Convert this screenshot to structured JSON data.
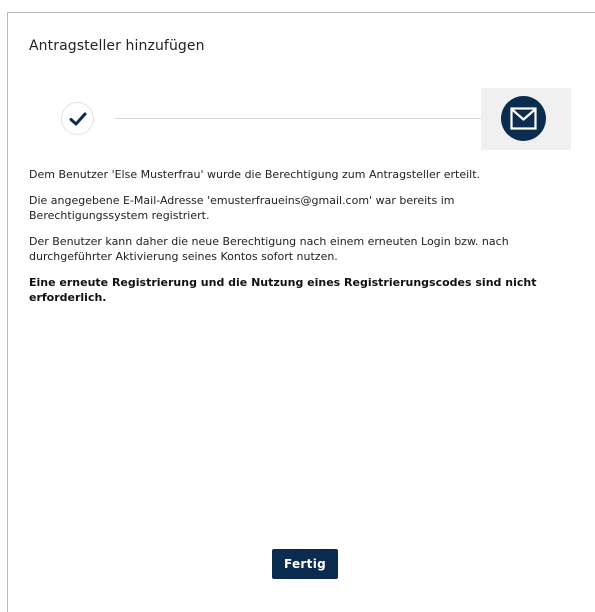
{
  "dialog": {
    "title": "Antragsteller hinzufügen"
  },
  "stepper": {
    "steps": [
      {
        "state": "completed",
        "icon": "checkmark-icon"
      },
      {
        "state": "active",
        "icon": "envelope-icon"
      }
    ]
  },
  "message": {
    "paragraphs": [
      "Dem Benutzer 'Else Musterfrau' wurde die Berechtigung zum Antragsteller erteilt.",
      "Die angegebene E-Mail-Adresse 'emusterfraueins@gmail.com' war bereits im Berechtigungssystem registriert.",
      "Der Benutzer kann daher die neue Berechtigung nach einem erneuten Login bzw. nach durchgeführter Aktivierung seines Kontos sofort nutzen.",
      "Eine erneute Registrierung und die Nutzung eines Registrierungscodes sind nicht erforderlich."
    ]
  },
  "actions": {
    "finish_label": "Fertig"
  },
  "colors": {
    "primary": "#0b2b4f",
    "step_active_background": "#f0f0f0",
    "divider": "#d9d9d9"
  }
}
